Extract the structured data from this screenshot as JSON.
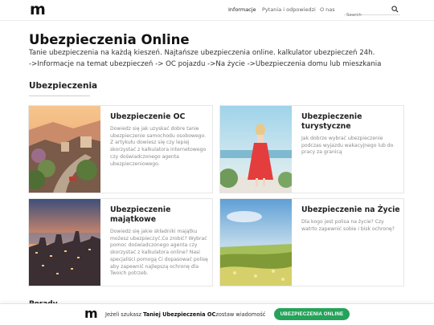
{
  "header": {
    "logo": "m",
    "nav": [
      {
        "label": "Informacje",
        "active": true
      },
      {
        "label": "Pytania i odpowiedzi",
        "active": false
      },
      {
        "label": "O nas",
        "active": false
      }
    ],
    "search_placeholder": "Search"
  },
  "main": {
    "title": "Ubezpieczenia Online",
    "intro_line1": "Tanie ubezpieczenia na każdą kieszeń. Najtańsze ubezpieczenia online. kalkulator ubezpieczeń 24h.",
    "intro_line2": "->Informacje na temat ubezpieczeń -> OC pojazdu ->Na życie ->Ubezpieczenia domu lub mieszkania",
    "section_title": "Ubezpieczenia",
    "cards": [
      {
        "title": "Ubezpieczenie OC",
        "description": "Dowiedz się jak uzyskać dobre tanie ubezpieczenie samochodu osobowego.\nZ artykułu dowiesz się czy lepiej skorzystać z kalkulatora internetowego czy doświadczonego agenta ubezpieczeniowego.",
        "image": "street-photo"
      },
      {
        "title": "Ubezpieczenie turystyczne",
        "description": "Jak dobrze wybrać ubezpieczenie podczas wyjazdu wakacyjnego lub do pracy za granicą",
        "image": "woman-red-dress-photo"
      },
      {
        "title": "Ubezpieczenie majątkowe",
        "description": "Dowiedz się jakie składniki majątku możesz ubezpieczyć.Co zrobić? Wybrać pomoc doświadczonego agenta czy skorzystać z kalkulatora online? Nasi specjaliści pomogą Ci dopasować polisę aby zapewnić najlepszą ochronę dla Twoich potrzeb.",
        "image": "city-sunset-photo"
      },
      {
        "title": "Ubezpieczenie na Życie",
        "description": "Dla kogo jest polisa na życie? Czy watrto zapewnić sobie i bisk ochronę?",
        "image": "meadow-photo"
      }
    ],
    "next_section_title": "Porady"
  },
  "bottom_bar": {
    "logo": "m",
    "text_before": "Jeżeli szukasz ",
    "text_bold": "Taniej Ubezpieczenia OC",
    "text_after": "zostaw wiadomość",
    "cta_label": "UBEZPIECZENIA ONLINE",
    "cta_color": "#25a35a"
  }
}
